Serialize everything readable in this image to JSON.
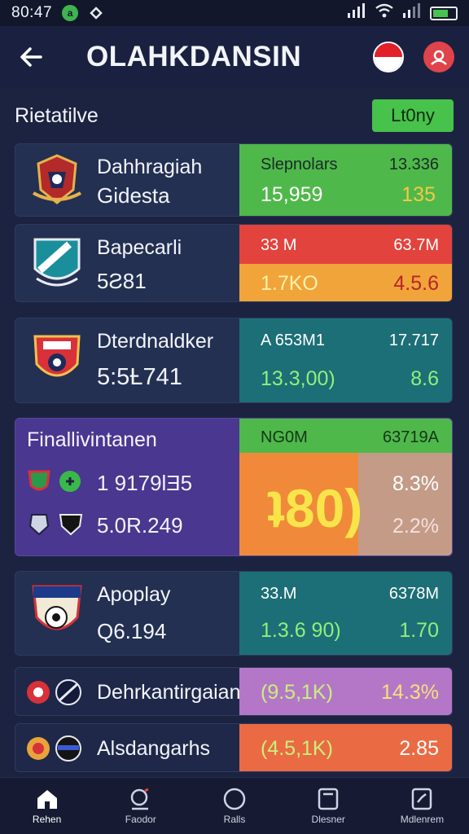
{
  "status": {
    "time": "80:47"
  },
  "header": {
    "title": "OLAHKDANSIN"
  },
  "section": {
    "title": "Rietatilve",
    "live_label": "Lt0ny"
  },
  "cards": [
    {
      "name": "Dahhragiah",
      "sub": "Gidesta",
      "stat_label_a": "Slepnolars",
      "stat_label_b": "13.336",
      "stat_value_a": "15,959",
      "stat_value_b": "135"
    },
    {
      "name": "Bapecarli",
      "sub": "5Ƨ81",
      "stat_label_a": "33 M",
      "stat_label_b": "63.7M",
      "stat_value_a": "1.7KO",
      "stat_value_b": "4.5.6"
    },
    {
      "name": "Dterdnaldker",
      "sub": "5:5Ƚ741",
      "stat_label_a": "A 653M1",
      "stat_label_b": "17.717",
      "stat_value_a": "13.3,00)",
      "stat_value_b": "8.6"
    },
    {
      "name": "Apoplay",
      "sub": "Q6.194",
      "stat_label_a": "33.M",
      "stat_label_b": "6378M",
      "stat_value_a": "1.3.6 90)",
      "stat_value_b": "1.70"
    }
  ],
  "featured": {
    "title": "Finallivintanen",
    "row1": "1 9179ƖƎ5",
    "row2": "5.0R.249",
    "label_a": "NG0M",
    "label_b": "63719A",
    "big": "ʇ80)",
    "pct_a": "8.3%",
    "pct_b": "2.2%"
  },
  "list": [
    {
      "name": "Dehrkantirgaian",
      "value_a": "(9.5,1K)",
      "value_b": "14.3%"
    },
    {
      "name": "Alsdangarhs",
      "value_a": "(4.5,1K)",
      "value_b": "2.85"
    }
  ],
  "nav": [
    {
      "label": "Rehen"
    },
    {
      "label": "Faodor"
    },
    {
      "label": "Ralls"
    },
    {
      "label": "Dlesner"
    },
    {
      "label": "Mdlenrem"
    }
  ],
  "colors": {
    "green": "#4fb84a",
    "red": "#e2433c",
    "orange": "#f1a43a",
    "teal": "#1c6f76",
    "purple": "#4a3790",
    "pink": "#b477c8"
  }
}
